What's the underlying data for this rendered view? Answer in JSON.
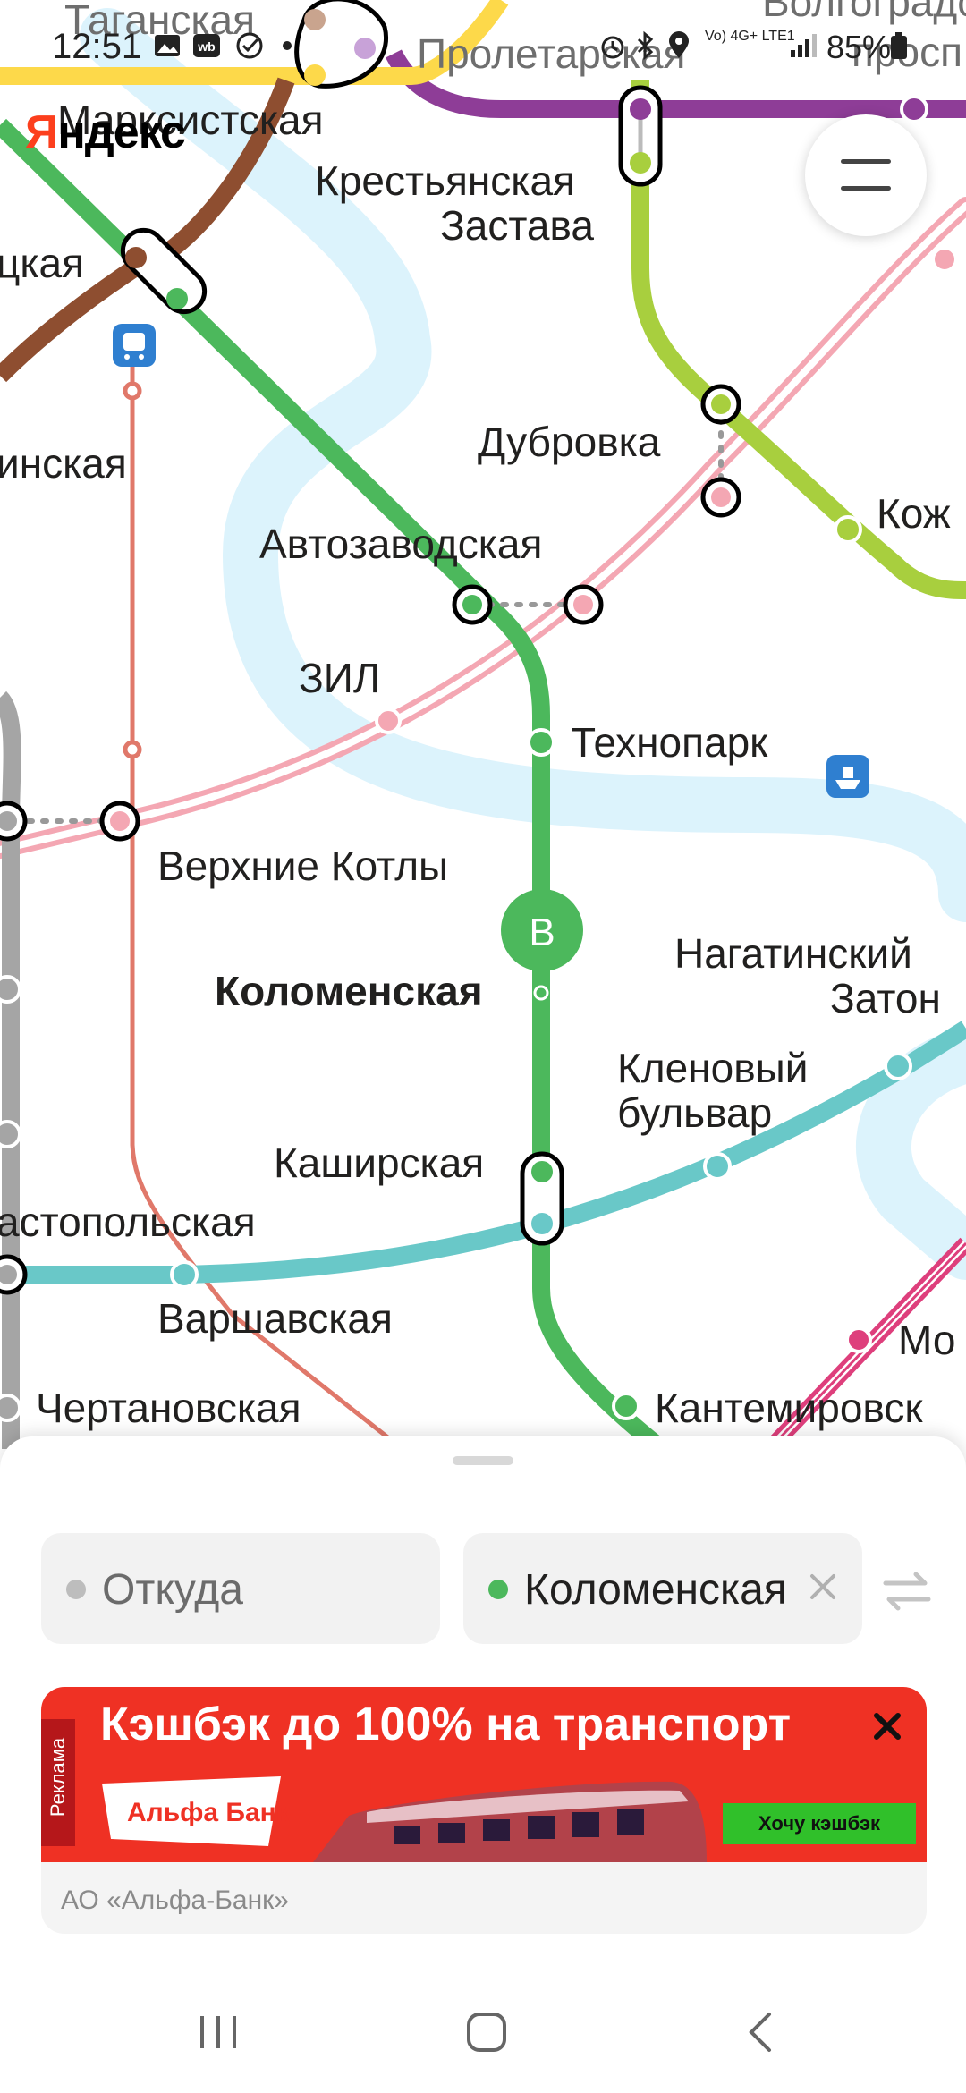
{
  "status_bar": {
    "time": "12:51",
    "network": "Vo) 4G+ LTE1",
    "battery": "85%",
    "notification_icons": [
      "image-icon",
      "wb-icon",
      "check-icon",
      "dot-icon"
    ],
    "status_icons": [
      "alarm-icon",
      "bluetooth-icon",
      "location-icon",
      "signal-icon",
      "battery-icon"
    ]
  },
  "header": {
    "logo_y": "Я",
    "logo_rest": "ндекс",
    "menu_icon": "hamburger-icon"
  },
  "map": {
    "colors": {
      "green_line": "#4cb85c",
      "brown_line": "#8e4e30",
      "purple_line": "#8e3d97",
      "salad_line": "#a8cf3e",
      "pink_line": "#f4a7b3",
      "teal_line": "#69c8c8",
      "gray_line": "#a5a5a5",
      "river": "#dcf3fc",
      "mcd_line": "#e0786a",
      "magenta_line": "#de3f7c",
      "yellow_line": "#fdd94a"
    },
    "stations": {
      "taganskaya": "Таганская",
      "proletarskaya": "Пролетарская",
      "volgogradsky_1": "Волгоградс",
      "volgogradsky_2": "просп",
      "marksistskaya": "Марксистская",
      "krestyanskaya_1": "Крестьянская",
      "krestyanskaya_2": "Застава",
      "tskaya": "цкая",
      "inskaya": "инская",
      "dubrovka": "Дубровка",
      "kozh": "Кож",
      "avtozavodskaya": "Автозаводская",
      "zil": "ЗИЛ",
      "tekhnopark": "Технопарк",
      "verkhnie_kotly": "Верхние Котлы",
      "kolomenskaya": "Коломенская",
      "nagatinsky_1": "Нагатинский",
      "nagatinsky_2": "Затон",
      "klenovy_1": "Кленовый",
      "klenovy_2": "бульвар",
      "kashirskaya": "Каширская",
      "sevastopolskaya": "астопольская",
      "varshavskaya": "Варшавская",
      "chertanovskaya": "Чертановская",
      "kantemirovskaya": "Кантемировск",
      "mo": "Мо"
    },
    "destination_marker": "B"
  },
  "route": {
    "from_placeholder": "Откуда",
    "to_value": "Коломенская",
    "from_dot_color": "#bdbdbd",
    "to_dot_color": "#4cb85c"
  },
  "ad": {
    "label": "Реклама",
    "headline": "Кэшбэк до 100% на транспорт",
    "bank": "Альфа Банк",
    "cta": "Хочу кэшбэк",
    "advertiser": "АО «Альфа-Банк»"
  }
}
